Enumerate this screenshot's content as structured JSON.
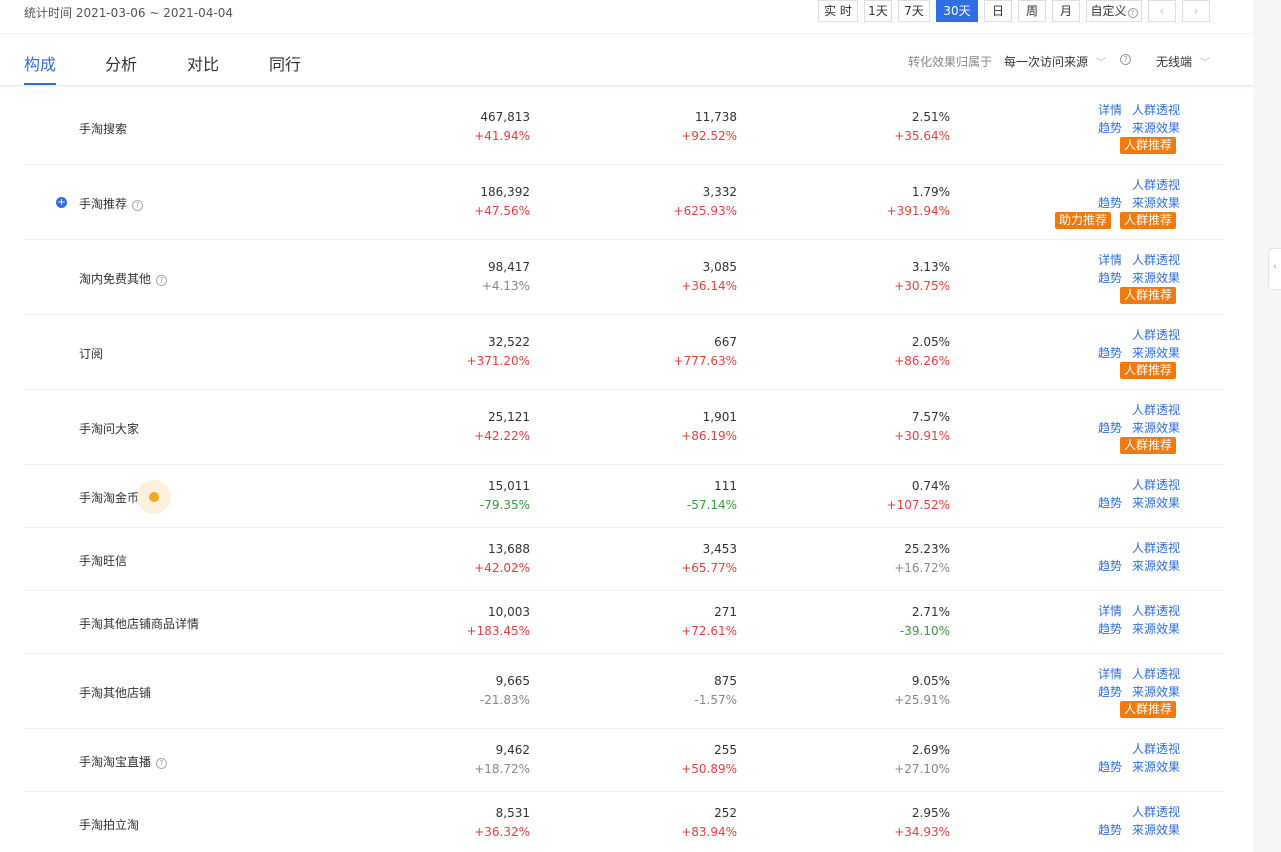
{
  "header": {
    "stat_time": "统计时间 2021-03-06 ~ 2021-04-04",
    "periods": [
      {
        "label": "实 时",
        "active": false
      },
      {
        "label": "1天",
        "active": false
      },
      {
        "label": "7天",
        "active": false
      },
      {
        "label": "30天",
        "active": true
      },
      {
        "label": "日",
        "active": false
      },
      {
        "label": "周",
        "active": false
      },
      {
        "label": "月",
        "active": false
      },
      {
        "label": "自定义",
        "active": false
      }
    ],
    "prev_label": "‹",
    "next_label": "›"
  },
  "tabs": [
    {
      "label": "构成",
      "active": true
    },
    {
      "label": "分析",
      "active": false
    },
    {
      "label": "对比",
      "active": false
    },
    {
      "label": "同行",
      "active": false
    }
  ],
  "filters": {
    "attribution_label": "转化效果归属于",
    "attribution_value": "每一次访问来源",
    "device_value": "无线端",
    "help_glyph": "?"
  },
  "ops_labels": {
    "detail": "详情",
    "crowd": "人群透视",
    "trend": "趋势",
    "source": "来源效果",
    "recommend": "人群推荐",
    "boost": "助力推荐"
  },
  "rows": [
    {
      "name": "手淘搜索",
      "help": false,
      "expand": false,
      "dot": false,
      "v1": "467,813",
      "c1": "+41.94%",
      "s1": "up",
      "v2": "11,738",
      "c2": "+92.52%",
      "s2": "up",
      "v3": "2.51%",
      "c3": "+35.64%",
      "s3": "up",
      "detail": true,
      "recommend": true,
      "boost": false
    },
    {
      "name": "手淘推荐",
      "help": true,
      "expand": true,
      "dot": false,
      "v1": "186,392",
      "c1": "+47.56%",
      "s1": "up",
      "v2": "3,332",
      "c2": "+625.93%",
      "s2": "up",
      "v3": "1.79%",
      "c3": "+391.94%",
      "s3": "up",
      "detail": false,
      "recommend": true,
      "boost": true
    },
    {
      "name": "淘内免费其他",
      "help": true,
      "expand": false,
      "dot": false,
      "v1": "98,417",
      "c1": "+4.13%",
      "s1": "flat",
      "v2": "3,085",
      "c2": "+36.14%",
      "s2": "up",
      "v3": "3.13%",
      "c3": "+30.75%",
      "s3": "up",
      "detail": true,
      "recommend": true,
      "boost": false
    },
    {
      "name": "订阅",
      "help": false,
      "expand": false,
      "dot": false,
      "v1": "32,522",
      "c1": "+371.20%",
      "s1": "up",
      "v2": "667",
      "c2": "+777.63%",
      "s2": "up",
      "v3": "2.05%",
      "c3": "+86.26%",
      "s3": "up",
      "detail": false,
      "recommend": true,
      "boost": false
    },
    {
      "name": "手淘问大家",
      "help": false,
      "expand": false,
      "dot": false,
      "v1": "25,121",
      "c1": "+42.22%",
      "s1": "up",
      "v2": "1,901",
      "c2": "+86.19%",
      "s2": "up",
      "v3": "7.57%",
      "c3": "+30.91%",
      "s3": "up",
      "detail": false,
      "recommend": true,
      "boost": false
    },
    {
      "name": "手淘淘金币",
      "help": false,
      "expand": false,
      "dot": true,
      "v1": "15,011",
      "c1": "-79.35%",
      "s1": "down",
      "v2": "111",
      "c2": "-57.14%",
      "s2": "down",
      "v3": "0.74%",
      "c3": "+107.52%",
      "s3": "up",
      "detail": false,
      "recommend": false,
      "boost": false
    },
    {
      "name": "手淘旺信",
      "help": false,
      "expand": false,
      "dot": false,
      "v1": "13,688",
      "c1": "+42.02%",
      "s1": "up",
      "v2": "3,453",
      "c2": "+65.77%",
      "s2": "up",
      "v3": "25.23%",
      "c3": "+16.72%",
      "s3": "flat",
      "detail": false,
      "recommend": false,
      "boost": false
    },
    {
      "name": "手淘其他店铺商品详情",
      "help": false,
      "expand": false,
      "dot": false,
      "v1": "10,003",
      "c1": "+183.45%",
      "s1": "up",
      "v2": "271",
      "c2": "+72.61%",
      "s2": "up",
      "v3": "2.71%",
      "c3": "-39.10%",
      "s3": "down",
      "detail": true,
      "recommend": false,
      "boost": false
    },
    {
      "name": "手淘其他店铺",
      "help": false,
      "expand": false,
      "dot": false,
      "v1": "9,665",
      "c1": "-21.83%",
      "s1": "flat",
      "v2": "875",
      "c2": "-1.57%",
      "s2": "flat",
      "v3": "9.05%",
      "c3": "+25.91%",
      "s3": "flat",
      "detail": true,
      "recommend": true,
      "boost": false
    },
    {
      "name": "手淘淘宝直播",
      "help": true,
      "expand": false,
      "dot": false,
      "v1": "9,462",
      "c1": "+18.72%",
      "s1": "flat",
      "v2": "255",
      "c2": "+50.89%",
      "s2": "up",
      "v3": "2.69%",
      "c3": "+27.10%",
      "s3": "flat",
      "detail": false,
      "recommend": false,
      "boost": false
    },
    {
      "name": "手淘拍立淘",
      "help": false,
      "expand": false,
      "dot": false,
      "v1": "8,531",
      "c1": "+36.32%",
      "s1": "up",
      "v2": "252",
      "c2": "+83.94%",
      "s2": "up",
      "v3": "2.95%",
      "c3": "+34.93%",
      "s3": "up",
      "detail": false,
      "recommend": false,
      "boost": false
    }
  ]
}
